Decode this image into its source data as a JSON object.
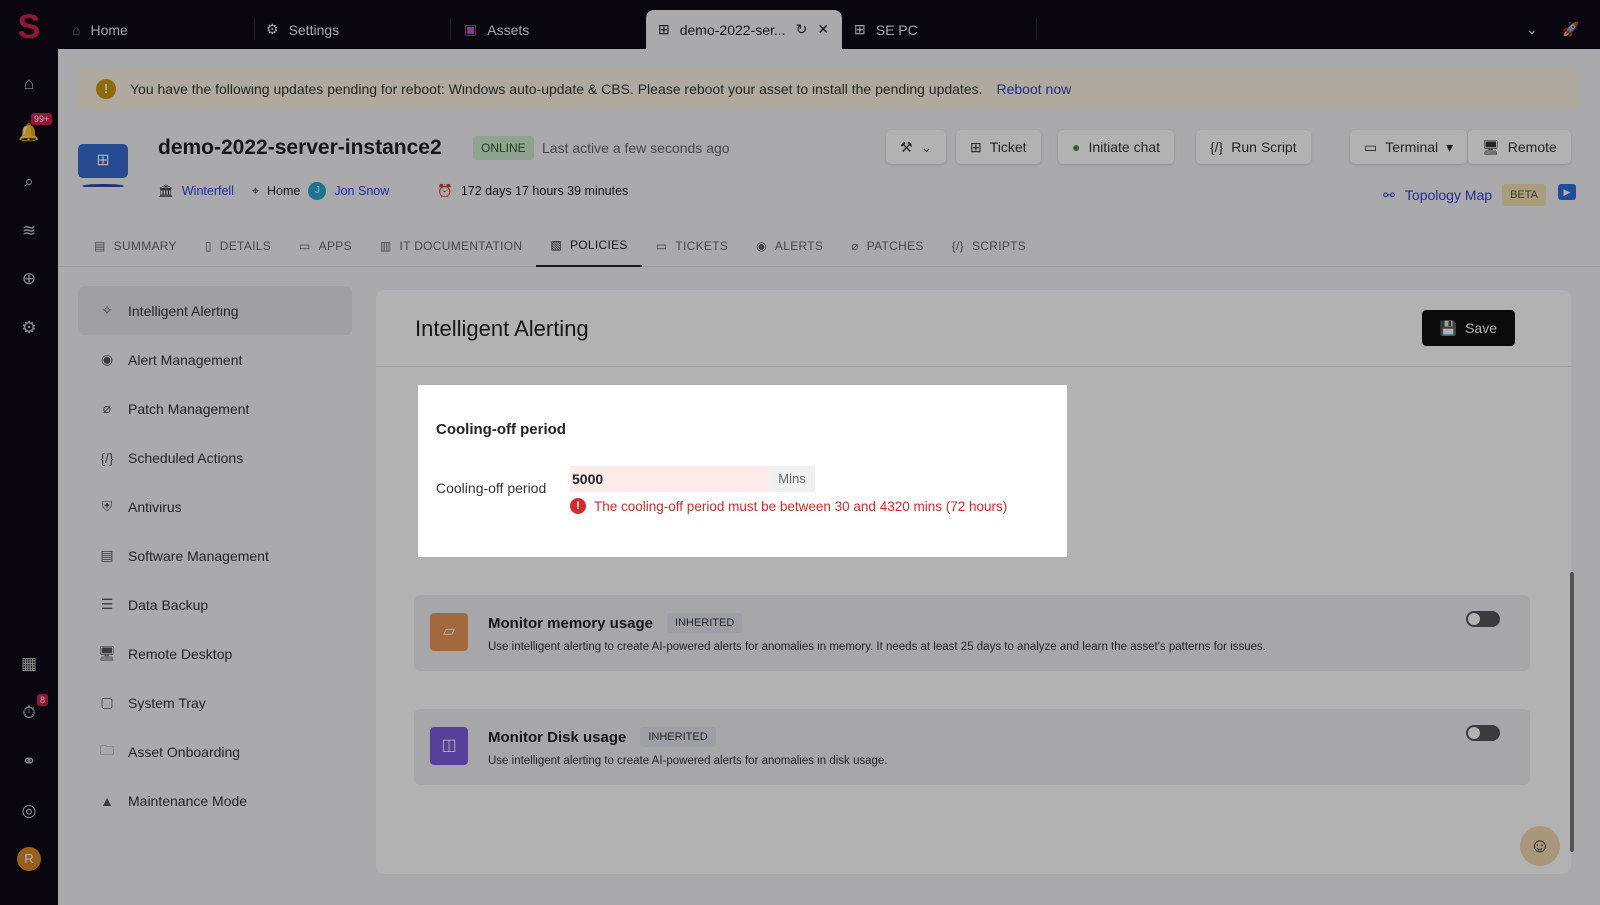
{
  "tabs": [
    {
      "label": "Home",
      "icon": "home-icon"
    },
    {
      "label": "Settings",
      "icon": "gear-icon"
    },
    {
      "label": "Assets",
      "icon": "assets-icon"
    },
    {
      "label": "demo-2022-ser...",
      "icon": "windows-icon"
    },
    {
      "label": "SE PC",
      "icon": "windows-icon"
    }
  ],
  "rail": {
    "notifications_badge": "99+",
    "tasks_badge": "8",
    "user_initial": "R"
  },
  "banner": {
    "text": "You have the following updates pending for reboot: Windows auto-update & CBS. Please reboot your asset to install the pending updates.",
    "link": "Reboot now"
  },
  "asset": {
    "name": "demo-2022-server-instance2",
    "status": "ONLINE",
    "last_active": "Last active a few seconds ago",
    "site": "Winterfell",
    "location": "Home",
    "user_initial": "J",
    "user": "Jon Snow",
    "uptime": "172 days 17 hours 39 minutes"
  },
  "actions": {
    "ticket": "Ticket",
    "chat": "Initiate chat",
    "run_script": "Run Script",
    "terminal": "Terminal",
    "remote": "Remote",
    "topology": "Topology Map",
    "beta": "BETA"
  },
  "nav_tabs": [
    "SUMMARY",
    "DETAILS",
    "APPS",
    "IT DOCUMENTATION",
    "POLICIES",
    "TICKETS",
    "ALERTS",
    "PATCHES",
    "SCRIPTS"
  ],
  "sidebar": [
    "Intelligent Alerting",
    "Alert Management",
    "Patch Management",
    "Scheduled Actions",
    "Antivirus",
    "Software Management",
    "Data Backup",
    "Remote Desktop",
    "System Tray",
    "Asset Onboarding",
    "Maintenance Mode"
  ],
  "panel": {
    "title": "Intelligent Alerting",
    "save": "Save"
  },
  "cards": [
    {
      "title": "Monitor memory usage",
      "badge": "INHERITED",
      "desc": "Use intelligent alerting to create AI-powered alerts for anomalies in memory. It needs at least 25 days to analyze and learn the asset's patterns for issues.",
      "enabled": false,
      "color": "#e8955a"
    },
    {
      "title": "Monitor Disk usage",
      "badge": "INHERITED",
      "desc": "Use intelligent alerting to create AI-powered alerts for anomalies in disk usage.",
      "enabled": false,
      "color": "#7a5ce0"
    }
  ],
  "modal": {
    "title": "Cooling-off period",
    "label": "Cooling-off period",
    "value": "5000",
    "unit": "Mins",
    "error": "The cooling-off period must be between 30 and 4320 mins (72 hours)"
  }
}
